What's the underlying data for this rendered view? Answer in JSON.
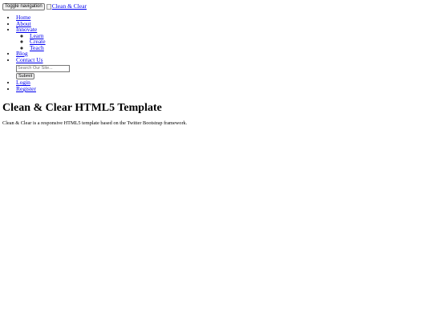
{
  "header": {
    "toggle_label": "Toggle navigation",
    "brand_alt": "Clean & Clear"
  },
  "nav": {
    "items": [
      {
        "label": "Home"
      },
      {
        "label": "About"
      },
      {
        "label": "Innovate",
        "children": [
          {
            "label": "Learn"
          },
          {
            "label": "Create"
          },
          {
            "label": "Teach"
          }
        ]
      },
      {
        "label": "Blog"
      },
      {
        "label": "Contact Us"
      }
    ]
  },
  "search": {
    "placeholder": "Search Our Site...",
    "submit_label": "Submit"
  },
  "account": {
    "login_label": "Login",
    "register_label": "Register"
  },
  "main": {
    "title": "Clean & Clear HTML5 Template",
    "description": "Clean & Clear is a responsive HTML5 template based on the Twitter Bootstrap framework."
  },
  "colors": {
    "link": "#0000ee",
    "text": "#000000",
    "background": "#ffffff"
  }
}
